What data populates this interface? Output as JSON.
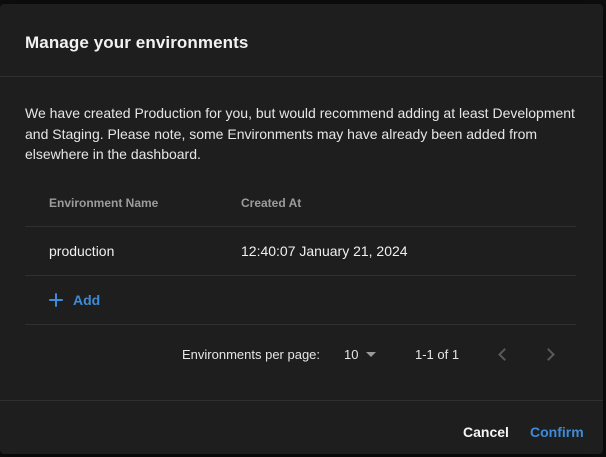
{
  "dialog": {
    "title": "Manage your environments",
    "description": "We have created Production for you, but would recommend adding at least Development and Staging. Please note, some Environments may have already been added from elsewhere in the dashboard."
  },
  "table": {
    "columns": [
      "Environment Name",
      "Created At"
    ],
    "rows": [
      {
        "name": "production",
        "created_at": "12:40:07 January 21, 2024"
      }
    ],
    "add_label": "Add"
  },
  "pagination": {
    "per_page_label": "Environments per page:",
    "per_page_value": "10",
    "range": "1-1 of 1"
  },
  "actions": {
    "cancel_label": "Cancel",
    "confirm_label": "Confirm"
  },
  "colors": {
    "accent": "#3d8bd9",
    "surface": "#1e1e1e",
    "divider": "#2f2f2f"
  },
  "icons": [
    "plus-icon",
    "chevron-down-icon",
    "chevron-left-icon",
    "chevron-right-icon"
  ]
}
